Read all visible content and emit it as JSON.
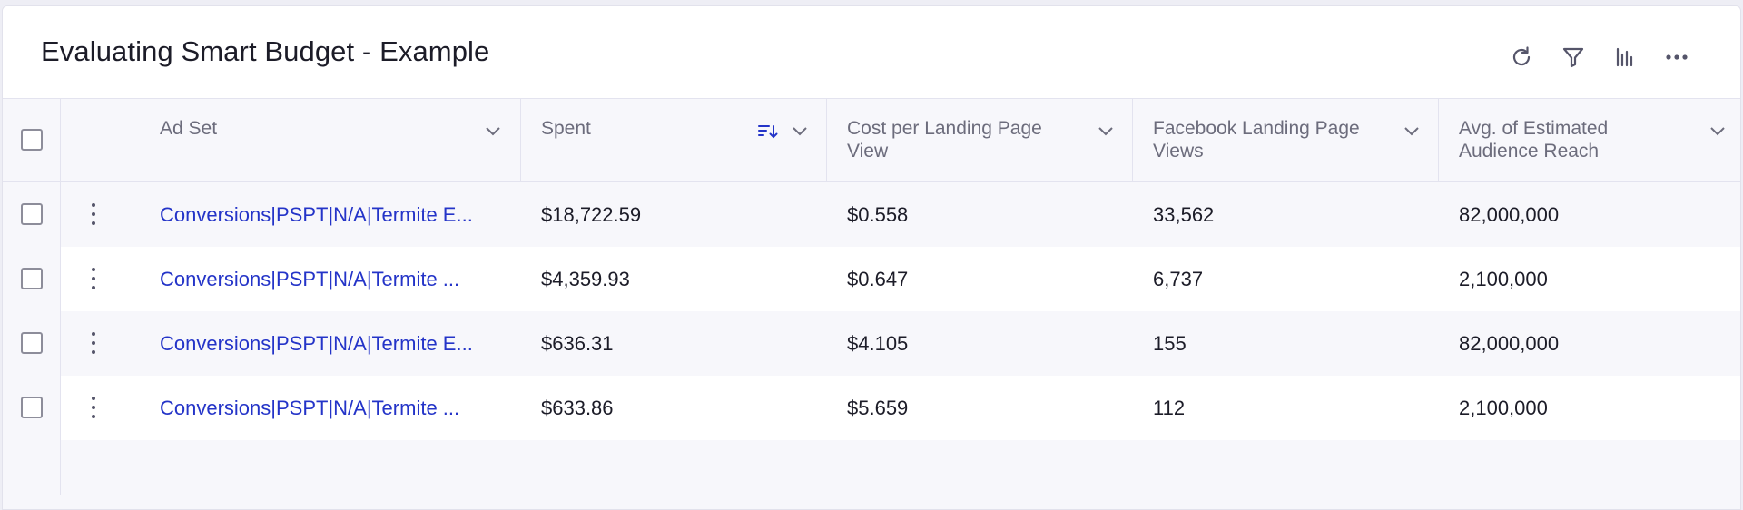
{
  "widget": {
    "title": "Evaluating Smart Budget - Example",
    "toolbar": {
      "refresh_icon": "refresh-icon",
      "filter_icon": "filter-icon",
      "chart_icon": "bar-chart-icon",
      "more_icon": "more-horizontal-icon"
    }
  },
  "table": {
    "columns": [
      {
        "key": "ad_set",
        "label": "Ad Set"
      },
      {
        "key": "spent",
        "label": "Spent",
        "sorted": "descending"
      },
      {
        "key": "cost_per_lpv",
        "label": "Cost per Landing Page View"
      },
      {
        "key": "fb_lpv",
        "label": "Facebook Landing Page Views"
      },
      {
        "key": "audience_reach",
        "label": "Avg. of Estimated Audience Reach"
      }
    ],
    "rows": [
      {
        "ad_set": "Conversions|PSPT|N/A|Termite E...",
        "spent": "$18,722.59",
        "cost_per_lpv": "$0.558",
        "fb_lpv": "33,562",
        "audience_reach": "82,000,000"
      },
      {
        "ad_set": "Conversions|PSPT|N/A|Termite ...",
        "spent": "$4,359.93",
        "cost_per_lpv": "$0.647",
        "fb_lpv": "6,737",
        "audience_reach": "2,100,000"
      },
      {
        "ad_set": "Conversions|PSPT|N/A|Termite E...",
        "spent": "$636.31",
        "cost_per_lpv": "$4.105",
        "fb_lpv": "155",
        "audience_reach": "82,000,000"
      },
      {
        "ad_set": "Conversions|PSPT|N/A|Termite ...",
        "spent": "$633.86",
        "cost_per_lpv": "$5.659",
        "fb_lpv": "112",
        "audience_reach": "2,100,000"
      }
    ]
  },
  "colors": {
    "link": "#2434c8",
    "accent": "#2434c8",
    "text": "#1c1c28",
    "header_text": "#6c6c7c"
  }
}
